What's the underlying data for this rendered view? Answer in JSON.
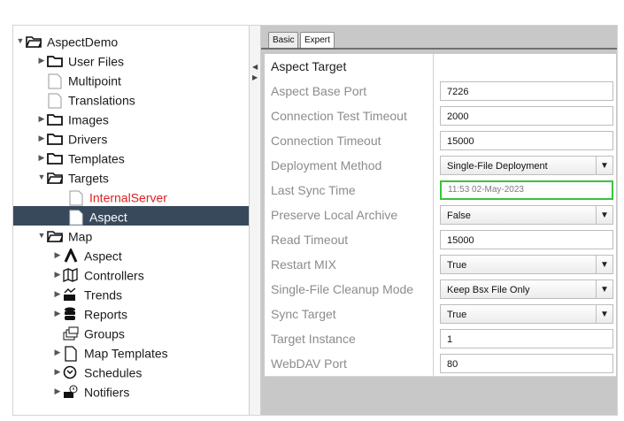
{
  "tree": {
    "items": [
      {
        "label": "AspectDemo",
        "icon": "folder-open-icon",
        "arrow": "▼"
      },
      {
        "label": "User Files",
        "icon": "folder-icon",
        "arrow": "▶"
      },
      {
        "label": "Multipoint",
        "icon": "file-icon",
        "arrow": ""
      },
      {
        "label": "Translations",
        "icon": "file-icon",
        "arrow": ""
      },
      {
        "label": "Images",
        "icon": "folder-icon",
        "arrow": "▶"
      },
      {
        "label": "Drivers",
        "icon": "folder-icon",
        "arrow": "▶"
      },
      {
        "label": "Templates",
        "icon": "folder-icon",
        "arrow": "▶"
      },
      {
        "label": "Targets",
        "icon": "folder-open-icon",
        "arrow": "▼"
      },
      {
        "label": "InternalServer",
        "icon": "file-icon",
        "arrow": ""
      },
      {
        "label": "Aspect",
        "icon": "file-icon",
        "arrow": ""
      },
      {
        "label": "Map",
        "icon": "folder-open-icon",
        "arrow": "▼"
      },
      {
        "label": "Aspect",
        "icon": "aspect-logo-icon",
        "arrow": "▶"
      },
      {
        "label": "Controllers",
        "icon": "controllers-icon",
        "arrow": "▶"
      },
      {
        "label": "Trends",
        "icon": "trends-icon",
        "arrow": "▶"
      },
      {
        "label": "Reports",
        "icon": "database-icon",
        "arrow": "▶"
      },
      {
        "label": "Groups",
        "icon": "groups-icon",
        "arrow": ""
      },
      {
        "label": "Map Templates",
        "icon": "page-icon",
        "arrow": "▶"
      },
      {
        "label": "Schedules",
        "icon": "clock-icon",
        "arrow": "▶"
      },
      {
        "label": "Notifiers",
        "icon": "notifier-icon",
        "arrow": "▶"
      }
    ],
    "selected_label": "Aspect",
    "highlight_color": "#e02020"
  },
  "tabs": [
    {
      "label": "Basic"
    },
    {
      "label": "Expert"
    }
  ],
  "properties": {
    "header": "Aspect Target",
    "rows": [
      {
        "name": "Aspect Base Port",
        "value": "7226",
        "type": "text"
      },
      {
        "name": "Connection Test Timeout",
        "value": "2000",
        "type": "text"
      },
      {
        "name": "Connection Timeout",
        "value": "15000",
        "type": "text"
      },
      {
        "name": "Deployment Method",
        "value": "Single-File Deployment",
        "type": "dropdown"
      },
      {
        "name": "Last Sync Time",
        "value": "11:53 02-May-2023",
        "type": "readonly"
      },
      {
        "name": "Preserve Local Archive",
        "value": "False",
        "type": "dropdown"
      },
      {
        "name": "Read Timeout",
        "value": "15000",
        "type": "text"
      },
      {
        "name": "Restart MIX",
        "value": "True",
        "type": "dropdown"
      },
      {
        "name": "Single-File Cleanup Mode",
        "value": "Keep Bsx File Only",
        "type": "dropdown"
      },
      {
        "name": "Sync Target",
        "value": "True",
        "type": "dropdown"
      },
      {
        "name": "Target Instance",
        "value": "1",
        "type": "text"
      },
      {
        "name": "WebDAV Port",
        "value": "80",
        "type": "text"
      }
    ]
  },
  "colors": {
    "selection": "#38495c",
    "focus_border": "#3cc23c",
    "panel_bg": "#c8c8c8"
  }
}
